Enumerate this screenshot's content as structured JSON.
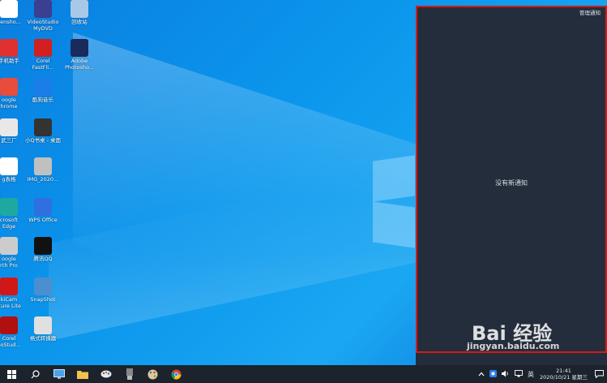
{
  "desktop": {
    "icons": [
      {
        "label": "eensho...",
        "icon": "screenshot-icon",
        "color": "#ffffff"
      },
      {
        "label": "VideoStudio\nMyDVD",
        "icon": "videostudio-icon",
        "color": "#3a3f8f"
      },
      {
        "label": "回收站",
        "icon": "recycle-bin-icon",
        "color": "#a8c8e8"
      },
      {
        "label": "手机助手",
        "icon": "phone-assistant-icon",
        "color": "#e03030"
      },
      {
        "label": "Corel\nFastFli...",
        "icon": "corel-fastflick-icon",
        "color": "#d02020"
      },
      {
        "label": "Adobe\nPhotosho...",
        "icon": "photoshop-icon",
        "color": "#1a2a5a"
      },
      {
        "label": "oogle\nhrome",
        "icon": "chrome-icon",
        "color": "#e84c3d"
      },
      {
        "label": "酷狗音乐",
        "icon": "kugou-icon",
        "color": "#1b7ee8"
      },
      {
        "label": "武三厂",
        "icon": "app-icon",
        "color": "#e8e8e8"
      },
      {
        "label": "小Q书桌 - 桌面",
        "icon": "desk-icon",
        "color": "#333333"
      },
      {
        "label": "g表格",
        "icon": "sheet-icon",
        "color": "#ffffff"
      },
      {
        "label": "IMG_2020...",
        "icon": "image-file-icon",
        "color": "#c0c0c0"
      },
      {
        "label": "crosoft\nEdge",
        "icon": "edge-icon",
        "color": "#1fa8a0"
      },
      {
        "label": "WPS Office",
        "icon": "wps-icon",
        "color": "#2f6fe0"
      },
      {
        "label": "oogle\nrth Pro",
        "icon": "earth-icon",
        "color": "#cccccc"
      },
      {
        "label": "腾讯QQ",
        "icon": "qq-icon",
        "color": "#111111"
      },
      {
        "label": "kiCam\nrture Lite",
        "icon": "capture-icon",
        "color": "#d01818"
      },
      {
        "label": "SnapShot",
        "icon": "snapshot-icon",
        "color": "#4a90d0"
      },
      {
        "label": "Corel\neoStud...",
        "icon": "corel-videostudio-icon",
        "color": "#b01010"
      },
      {
        "label": "格式转换器",
        "icon": "converter-icon",
        "color": "#e0e0e0"
      }
    ]
  },
  "panel": {
    "manage_label": "管理通知",
    "empty_label": "没有新通知"
  },
  "watermark": {
    "logo": "Bai 经验",
    "url": "jingyan.baidu.com"
  },
  "taskbar": {
    "ime": "英",
    "time": "21:41",
    "date": "2020/10/21 星期三"
  }
}
